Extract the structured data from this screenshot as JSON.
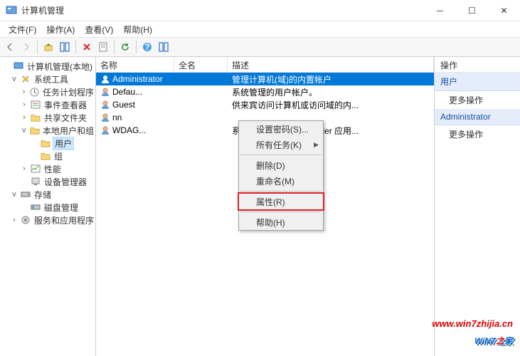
{
  "window": {
    "title": "计算机管理"
  },
  "menubar": {
    "file": "文件(F)",
    "action": "操作(A)",
    "view": "查看(V)",
    "help": "帮助(H)"
  },
  "tree": {
    "root": "计算机管理(本地)",
    "system_tools": "系统工具",
    "task_scheduler": "任务计划程序",
    "event_viewer": "事件查看器",
    "shared_folders": "共享文件夹",
    "local_users_groups": "本地用户和组",
    "users": "用户",
    "groups": "组",
    "performance": "性能",
    "device_manager": "设备管理器",
    "storage": "存储",
    "disk_management": "磁盘管理",
    "services_apps": "服务和应用程序"
  },
  "columns": {
    "name": "名称",
    "fullname": "全名",
    "description": "描述"
  },
  "users": [
    {
      "name": "Administrator",
      "full": "",
      "desc": "管理计算机(域)的内置帐户"
    },
    {
      "name": "Defau...",
      "full": "",
      "desc": "系统管理的用户帐户。"
    },
    {
      "name": "Guest",
      "full": "",
      "desc": "供来宾访问计算机或访问域的内..."
    },
    {
      "name": "nn",
      "full": "",
      "desc": ""
    },
    {
      "name": "WDAG...",
      "full": "",
      "desc": "系统为 Windows Defender 应用..."
    }
  ],
  "context_menu": {
    "set_password": "设置密码(S)...",
    "all_tasks": "所有任务(K)",
    "delete": "删除(D)",
    "rename": "重命名(M)",
    "properties": "属性(R)",
    "help": "帮助(H)"
  },
  "actions": {
    "header": "操作",
    "users_section": "用户",
    "more_actions": "更多操作",
    "admin_section": "Administrator"
  },
  "watermark": {
    "url": "www.win7zhijia.cn",
    "logo_a": "WiN7",
    "logo_b": "家"
  }
}
